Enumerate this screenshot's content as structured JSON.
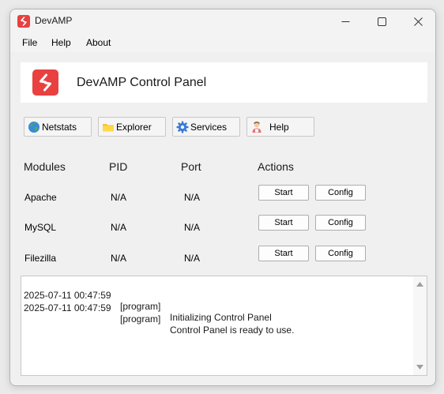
{
  "window": {
    "title": "DevAMP"
  },
  "menu": {
    "file": "File",
    "help": "Help",
    "about": "About"
  },
  "header": {
    "title": "DevAMP Control Panel"
  },
  "toolbar": {
    "netstats": "Netstats",
    "explorer": "Explorer",
    "services": "Services",
    "help": "Help"
  },
  "columns": {
    "modules": "Modules",
    "pid": "PID",
    "port": "Port",
    "actions": "Actions"
  },
  "modules": [
    {
      "name": "Apache",
      "pid": "N/A",
      "port": "N/A",
      "start": "Start",
      "config": "Config"
    },
    {
      "name": "MySQL",
      "pid": "N/A",
      "port": "N/A",
      "start": "Start",
      "config": "Config"
    },
    {
      "name": "Filezilla",
      "pid": "N/A",
      "port": "N/A",
      "start": "Start",
      "config": "Config"
    }
  ],
  "log": [
    {
      "time": "2025-07-11 00:47:59",
      "source": "[program]",
      "message": "Initializing Control Panel"
    },
    {
      "time": "2025-07-11 00:47:59",
      "source": "[program]",
      "message": "Control Panel is ready to use."
    }
  ],
  "colors": {
    "brand": "#e94040",
    "folder": "#f6c431",
    "gear": "#3a7bd5"
  },
  "icons": {
    "app": "app-logo-icon",
    "netstats": "globe-icon",
    "explorer": "folder-icon",
    "services": "gear-icon",
    "help": "help-person-icon"
  }
}
